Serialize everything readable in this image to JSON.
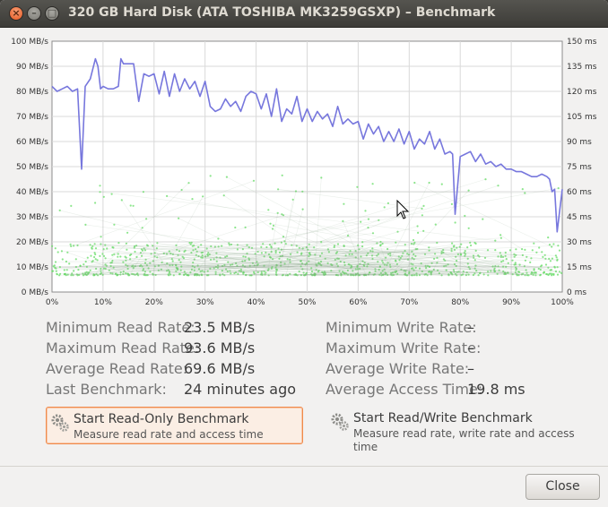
{
  "window": {
    "title": "320 GB Hard Disk (ATA TOSHIBA MK3259GSXP) – Benchmark",
    "close_glyph": "×",
    "min_glyph": "–",
    "max_glyph": "□"
  },
  "chart_data": {
    "type": "line",
    "x_unit": "%",
    "x_ticks": [
      "0%",
      "10%",
      "20%",
      "30%",
      "40%",
      "50%",
      "60%",
      "70%",
      "80%",
      "90%",
      "100%"
    ],
    "y_left_ticks": [
      "100 MB/s",
      "90 MB/s",
      "80 MB/s",
      "70 MB/s",
      "60 MB/s",
      "50 MB/s",
      "40 MB/s",
      "30 MB/s",
      "20 MB/s",
      "10 MB/s",
      "0 MB/s"
    ],
    "y_right_ticks": [
      "150 ms",
      "135 ms",
      "120 ms",
      "105 ms",
      "90 ms",
      "75 ms",
      "60 ms",
      "45 ms",
      "30 ms",
      "15 ms",
      "0 ms"
    ],
    "ylim_left": [
      0,
      100
    ],
    "ylim_right": [
      0,
      150
    ],
    "grid": true,
    "series": [
      {
        "kind": "read-rate",
        "color": "#7777dd",
        "x": [
          0,
          1,
          2,
          3,
          4,
          5,
          5.8,
          6.5,
          7.5,
          8.5,
          9,
          9.5,
          10,
          11,
          12,
          13,
          13.5,
          14,
          15,
          16,
          17,
          18,
          19,
          20,
          21,
          22,
          23,
          24,
          25,
          26,
          27,
          28,
          29,
          30,
          31,
          32,
          33,
          34,
          35,
          36,
          37,
          38,
          39,
          40,
          41,
          42,
          43,
          44,
          45,
          46,
          47,
          48,
          49,
          50,
          51,
          52,
          53,
          54,
          55,
          56,
          57,
          58,
          59,
          60,
          61,
          62,
          63,
          64,
          65,
          66,
          67,
          68,
          69,
          70,
          71,
          72,
          73,
          74,
          75,
          76,
          77,
          78,
          78.5,
          79,
          80,
          81,
          82,
          83,
          84,
          85,
          86,
          87,
          88,
          89,
          90,
          91,
          92,
          93,
          94,
          95,
          96,
          97,
          97.5,
          98,
          98.5,
          99,
          100
        ],
        "values": [
          82,
          80,
          81,
          82,
          80,
          81,
          49,
          82,
          85,
          93,
          90,
          81,
          82,
          81,
          81,
          82,
          93,
          91,
          91,
          91,
          76,
          87,
          86,
          87,
          79,
          88,
          78,
          87,
          80,
          85,
          81,
          84,
          78,
          84,
          74,
          72,
          73,
          77,
          74,
          76,
          72,
          78,
          80,
          79,
          73,
          79,
          70,
          81,
          68,
          73,
          71,
          78,
          68,
          73,
          68,
          72,
          69,
          71,
          66,
          74,
          67,
          69,
          67,
          68,
          61,
          67,
          63,
          66,
          60,
          64,
          60,
          65,
          59,
          64,
          57,
          61,
          59,
          64,
          57,
          61,
          55,
          56,
          55,
          31,
          54,
          55,
          56,
          52,
          55,
          51,
          52,
          50,
          51,
          49,
          49,
          48,
          48,
          47,
          46,
          46,
          47,
          46,
          45,
          40,
          41,
          24,
          41
        ]
      },
      {
        "kind": "access-time-samples",
        "color": "#66dd66",
        "typical_range_ms": [
          10,
          30
        ],
        "sample_count": 1000
      }
    ]
  },
  "stats": {
    "left": [
      {
        "label": "Minimum Read Rate:",
        "value": "23.5 MB/s"
      },
      {
        "label": "Maximum Read Rate:",
        "value": "93.6 MB/s"
      },
      {
        "label": "Average Read Rate:",
        "value": "69.6 MB/s"
      },
      {
        "label": "Last Benchmark:",
        "value": "24 minutes ago"
      }
    ],
    "right": [
      {
        "label": "Minimum Write Rate:",
        "value": "–"
      },
      {
        "label": "Maximum Write Rate:",
        "value": "–"
      },
      {
        "label": "Average Write Rate:",
        "value": "–"
      },
      {
        "label": "Average Access Time:",
        "value": "19.8 ms"
      }
    ]
  },
  "buttons": {
    "read_only": {
      "title": "Start Read-Only Benchmark",
      "desc": "Measure read rate and access time",
      "icon": "gears-icon"
    },
    "read_write": {
      "title": "Start Read/Write Benchmark",
      "desc_line1": "Measure read rate, write rate and access",
      "desc_line2": "time",
      "icon": "gears-icon"
    },
    "close": "Close"
  },
  "colors": {
    "accent": "#f08a4b",
    "read_line": "#7777dd",
    "access_dots": "#66dd66"
  }
}
